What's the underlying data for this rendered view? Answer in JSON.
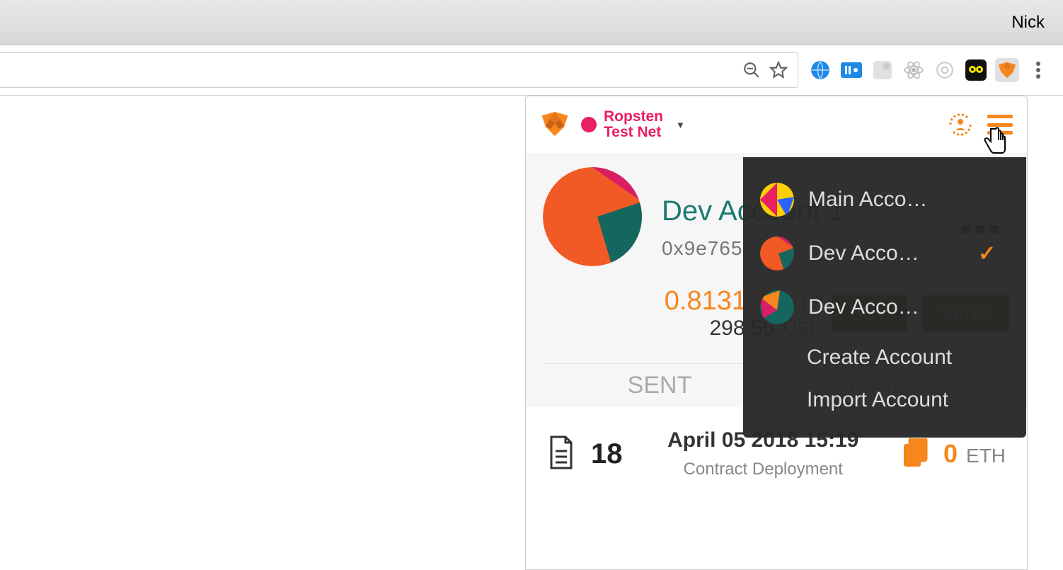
{
  "titlebar": {
    "user": "Nick"
  },
  "network": {
    "label_l1": "Ropsten",
    "label_l2": "Test Net"
  },
  "account": {
    "name": "Dev Account 1",
    "address_short": "0x9e765...",
    "eth": "0.813130",
    "eth_unit": "ETH",
    "usd": "298.55",
    "usd_unit": "USD",
    "btn_buy": "BUY",
    "btn_send": "SEND"
  },
  "tabs": {
    "sent": "SENT",
    "tokens": "TOKENS"
  },
  "tx": {
    "nonce": "18",
    "date": "April 05 2018 15:19",
    "desc": "Contract Deployment",
    "amount": "0",
    "unit": "ETH"
  },
  "switcher": {
    "items": [
      {
        "label": "Main Acco…",
        "selected": false
      },
      {
        "label": "Dev Acco…",
        "selected": true
      },
      {
        "label": "Dev Acco…",
        "selected": false
      }
    ],
    "create": "Create Account",
    "import": "Import Account"
  }
}
